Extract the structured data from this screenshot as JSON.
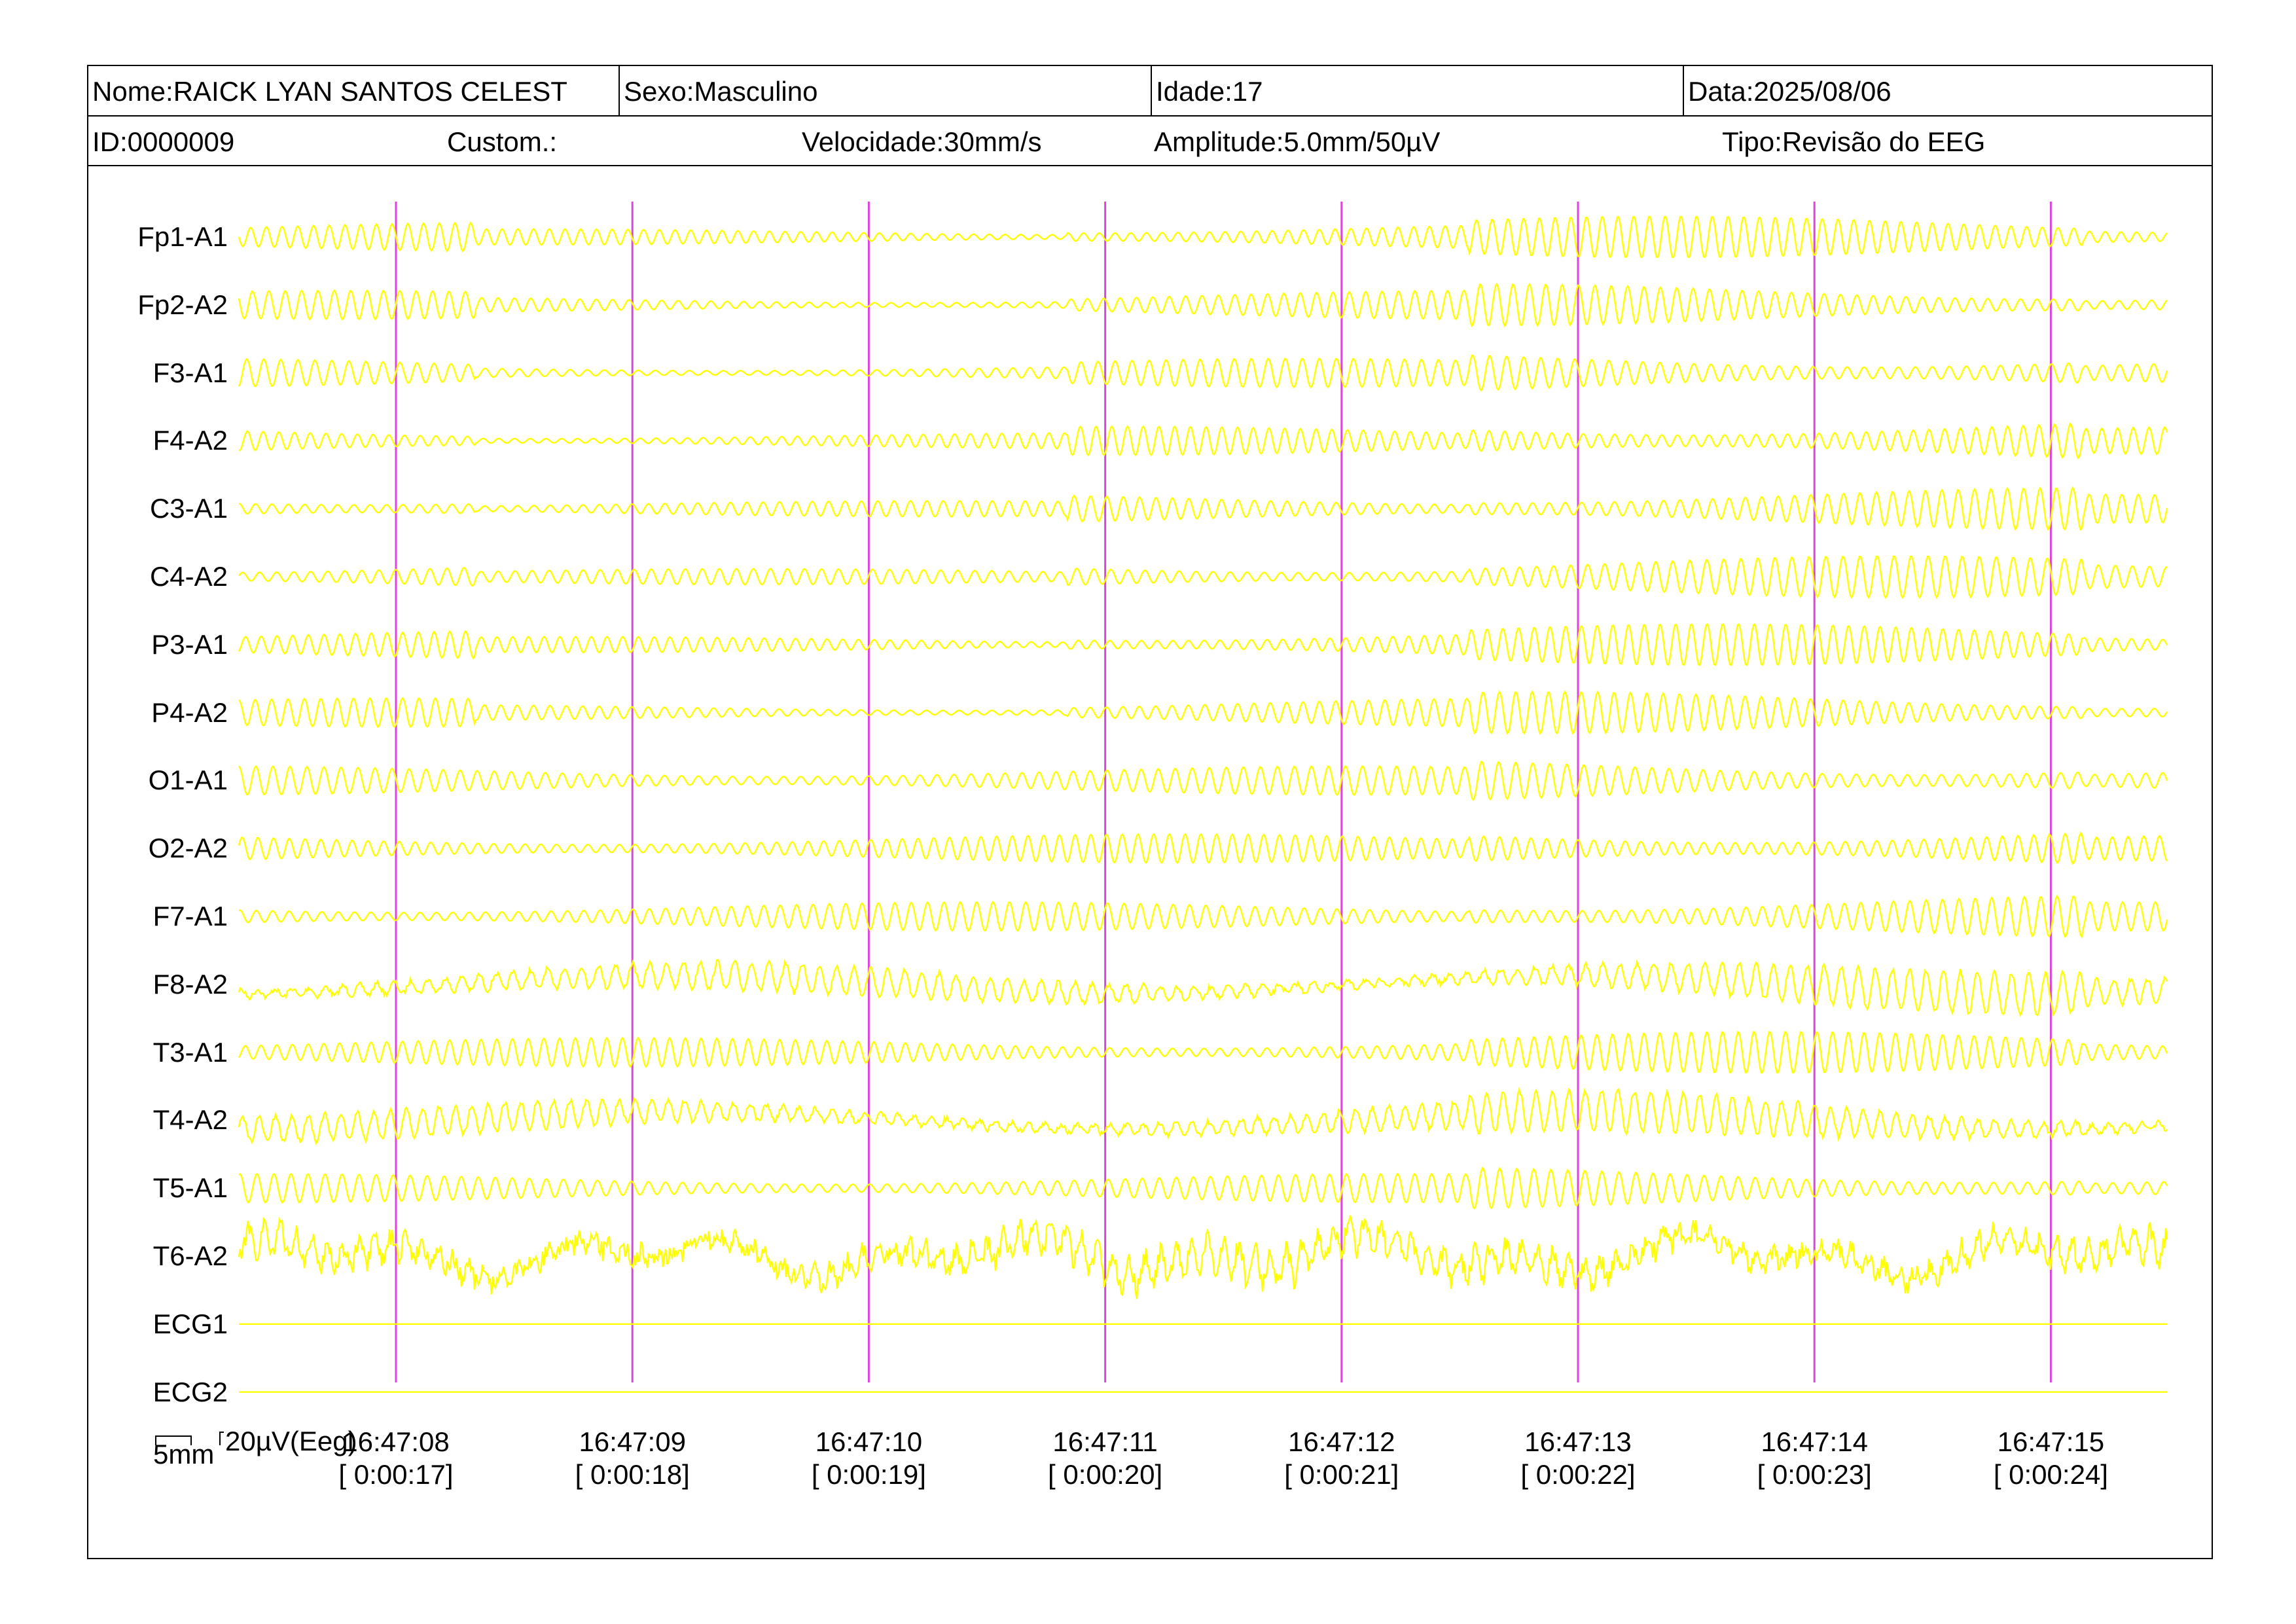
{
  "header": {
    "name": "Nome:RAICK LYAN SANTOS CELEST",
    "sex": "Sexo:Masculino",
    "age": "Idade:17",
    "date": "Data:2025/08/06",
    "id": "ID:0000009",
    "custom": "Custom.:",
    "speed": "Velocidade:30mm/s",
    "amplitude": "Amplitude:5.0mm/50µV",
    "type": "Tipo:Revisão do EEG"
  },
  "channels": [
    "Fp1-A1",
    "Fp2-A2",
    "F3-A1",
    "F4-A2",
    "C3-A1",
    "C4-A2",
    "P3-A1",
    "P4-A2",
    "O1-A1",
    "O2-A2",
    "F7-A1",
    "F8-A2",
    "T3-A1",
    "T4-A2",
    "T5-A1",
    "T6-A2",
    "ECG1",
    "ECG2"
  ],
  "time_marks": [
    {
      "clock": "16:47:08",
      "elapsed": "[ 0:00:17]"
    },
    {
      "clock": "16:47:09",
      "elapsed": "[ 0:00:18]"
    },
    {
      "clock": "16:47:10",
      "elapsed": "[ 0:00:19]"
    },
    {
      "clock": "16:47:11",
      "elapsed": "[ 0:00:20]"
    },
    {
      "clock": "16:47:12",
      "elapsed": "[ 0:00:21]"
    },
    {
      "clock": "16:47:13",
      "elapsed": "[ 0:00:22]"
    },
    {
      "clock": "16:47:14",
      "elapsed": "[ 0:00:23]"
    },
    {
      "clock": "16:47:15",
      "elapsed": "[ 0:00:24]"
    }
  ],
  "scale": {
    "time": "5mm",
    "amplitude": "20µV(Eeg)"
  },
  "colors": {
    "trace": "#ffff00",
    "second_marker": "#dd44dd",
    "border": "#000000"
  }
}
